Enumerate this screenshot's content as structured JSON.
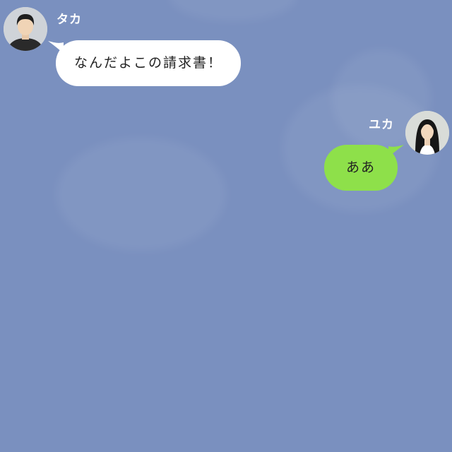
{
  "chat": {
    "messages": [
      {
        "sender": "タカ",
        "text": "なんだよこの請求書！",
        "side": "left",
        "avatar": "male-user-avatar-icon"
      },
      {
        "sender": "ユカ",
        "text": "ああ",
        "side": "right",
        "avatar": "female-user-avatar-icon"
      }
    ]
  },
  "colors": {
    "background": "#7a90bf",
    "incoming_bubble": "#ffffff",
    "outgoing_bubble": "#8ee04a",
    "sender_name": "#ffffff"
  }
}
